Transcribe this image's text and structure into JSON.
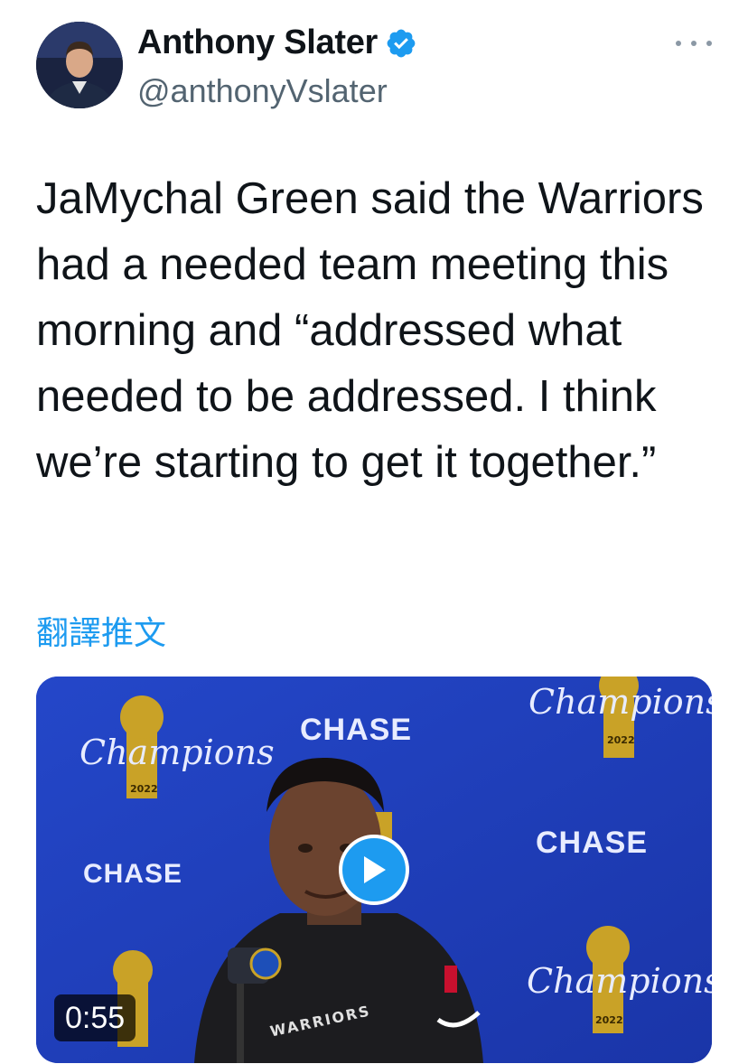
{
  "author": {
    "display_name": "Anthony Slater",
    "handle": "@anthonyVslater",
    "verified": true,
    "avatar_icon": "avatar-photo"
  },
  "tweet": {
    "text": "JaMychal Green said the Warriors had a needed team meeting this morning and “addressed what needed to be addressed. I think we’re starting to get it together.”",
    "translate_label": "翻譯推文"
  },
  "media": {
    "type": "video",
    "duration": "0:55",
    "play_icon": "play-icon",
    "backdrop_sponsor": "CHASE",
    "backdrop_logo_text": "Champions",
    "backdrop_year": "2022",
    "shirt_text": "WARRIORS",
    "colors": {
      "backdrop_blue": "#1f3fbf",
      "gold": "#c9a227",
      "play_blue": "#1d9bf0"
    }
  },
  "colors": {
    "text": "#0f1419",
    "secondary": "#536471",
    "link": "#1d9bf0",
    "verified": "#1d9bf0"
  }
}
